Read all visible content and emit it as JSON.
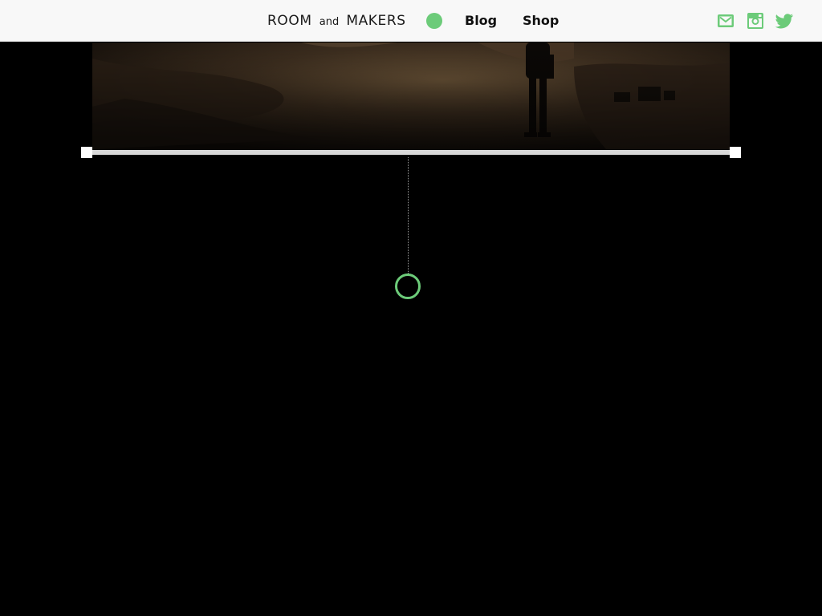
{
  "header": {
    "logo": {
      "part1": "ROOM",
      "part2": "and",
      "part3": "MAKERS"
    },
    "nav": [
      {
        "label": "Blog"
      },
      {
        "label": "Shop"
      }
    ],
    "social_icons": [
      "mail-icon",
      "instagram-icon",
      "twitter-icon"
    ],
    "accent_color": "#6ccb79"
  },
  "hero": {
    "image_description_icon": "hero-photo"
  },
  "slider": {
    "track_color": "#d9d9d9",
    "handle_color": "#ffffff"
  },
  "marker": {
    "ring_color": "#6ccb79"
  }
}
